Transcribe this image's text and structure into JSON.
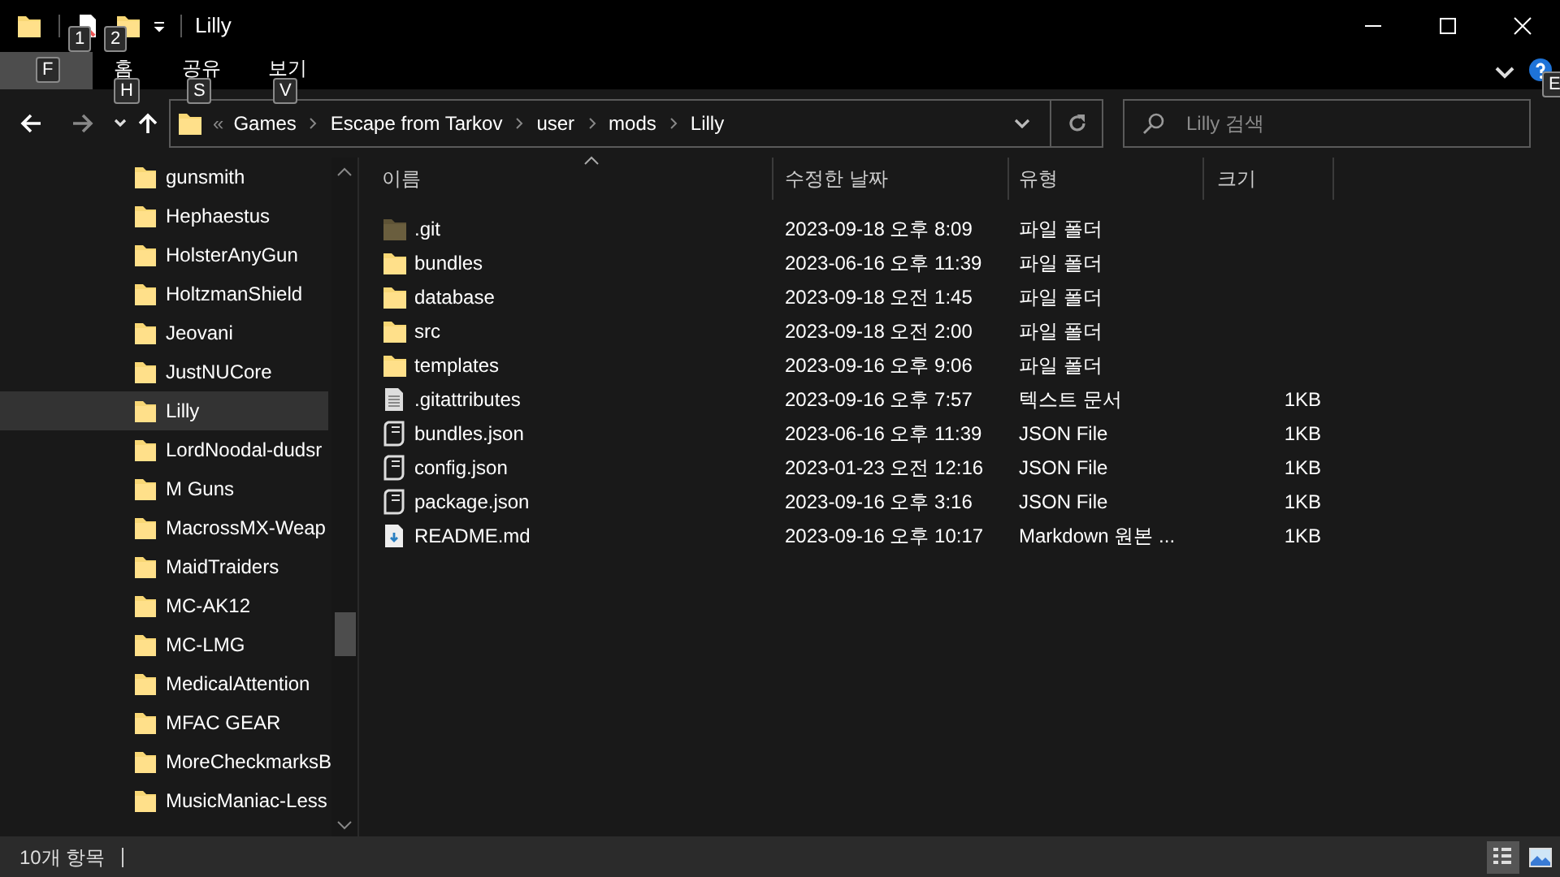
{
  "window": {
    "title": "Lilly",
    "quick_access_keytips": [
      "1",
      "2"
    ]
  },
  "ribbon": {
    "file_keytip": "F",
    "tabs": [
      {
        "label": "홈",
        "keytip": "H"
      },
      {
        "label": "공유",
        "keytip": "S"
      },
      {
        "label": "보기",
        "keytip": "V"
      }
    ],
    "help_keytip": "E"
  },
  "address_bar": {
    "overflow": "«",
    "path": [
      "Games",
      "Escape from Tarkov",
      "user",
      "mods",
      "Lilly"
    ]
  },
  "search": {
    "placeholder": "Lilly 검색"
  },
  "sidebar": {
    "items": [
      {
        "label": "gunsmith",
        "selected": false
      },
      {
        "label": "Hephaestus",
        "selected": false
      },
      {
        "label": "HolsterAnyGun",
        "selected": false
      },
      {
        "label": "HoltzmanShield",
        "selected": false
      },
      {
        "label": "Jeovani",
        "selected": false
      },
      {
        "label": "JustNUCore",
        "selected": false
      },
      {
        "label": "Lilly",
        "selected": true
      },
      {
        "label": "LordNoodal-dudsr",
        "selected": false
      },
      {
        "label": "M Guns",
        "selected": false
      },
      {
        "label": "MacrossMX-Weap",
        "selected": false
      },
      {
        "label": "MaidTraiders",
        "selected": false
      },
      {
        "label": "MC-AK12",
        "selected": false
      },
      {
        "label": "MC-LMG",
        "selected": false
      },
      {
        "label": "MedicalAttention",
        "selected": false
      },
      {
        "label": "MFAC GEAR",
        "selected": false
      },
      {
        "label": "MoreCheckmarksB",
        "selected": false
      },
      {
        "label": "MusicManiac-Less",
        "selected": false
      }
    ]
  },
  "table": {
    "columns": [
      "이름",
      "수정한 날짜",
      "유형",
      "크기"
    ],
    "rows": [
      {
        "kind": "folder",
        "hidden": true,
        "name": ".git",
        "date": "2023-09-18 오후 8:09",
        "type": "파일 폴더"
      },
      {
        "kind": "folder",
        "hidden": false,
        "name": "bundles",
        "date": "2023-06-16 오후 11:39",
        "type": "파일 폴더"
      },
      {
        "kind": "folder",
        "hidden": false,
        "name": "database",
        "date": "2023-09-18 오전 1:45",
        "type": "파일 폴더"
      },
      {
        "kind": "folder",
        "hidden": false,
        "name": "src",
        "date": "2023-09-18 오전 2:00",
        "type": "파일 폴더"
      },
      {
        "kind": "folder",
        "hidden": false,
        "name": "templates",
        "date": "2023-09-16 오후 9:06",
        "type": "파일 폴더"
      },
      {
        "kind": "text",
        "hidden": false,
        "name": ".gitattributes",
        "date": "2023-09-16 오후 7:57",
        "type": "텍스트 문서",
        "size": "1KB"
      },
      {
        "kind": "script",
        "hidden": false,
        "name": "bundles.json",
        "date": "2023-06-16 오후 11:39",
        "type": "JSON File",
        "size": "1KB"
      },
      {
        "kind": "script",
        "hidden": false,
        "name": "config.json",
        "date": "2023-01-23 오전 12:16",
        "type": "JSON File",
        "size": "1KB"
      },
      {
        "kind": "script",
        "hidden": false,
        "name": "package.json",
        "date": "2023-09-16 오후 3:16",
        "type": "JSON File",
        "size": "1KB"
      },
      {
        "kind": "markdown",
        "hidden": false,
        "name": "README.md",
        "date": "2023-09-16 오후 10:17",
        "type": "Markdown 원본 ...",
        "size": "1KB"
      }
    ]
  },
  "status_bar": {
    "item_count": "10개 항목",
    "views": [
      {
        "kind": "details",
        "selected": true
      },
      {
        "kind": "large",
        "selected": false
      }
    ]
  }
}
